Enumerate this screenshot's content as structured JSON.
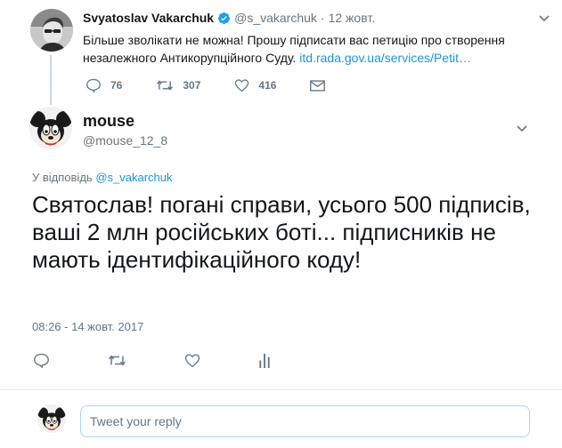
{
  "parent_tweet": {
    "author_name": "Svyatoslav Vakarchuk",
    "author_handle": "@s_vakarchuk",
    "separator": "·",
    "date": "12 жовт.",
    "text": "Більше зволікати не можна! Прошу підписати вас петицію про створення незалежного Антикорупційного Суду.",
    "link_text": "itd.rada.gov.ua/services/Petit…",
    "reply_count": "76",
    "retweet_count": "307",
    "like_count": "416",
    "verified": true
  },
  "main_tweet": {
    "author_name": "mouse",
    "author_handle": "@mouse_12_8",
    "replying_label": "У відповідь",
    "replying_to": "@s_vakarchuk",
    "text": "Святослав! погані справи, усього 500 підписів, ваші 2 млн російських боті... підписників не мають ідентифікаційного коду!",
    "timestamp": "08:26 - 14 жовт. 2017"
  },
  "compose": {
    "placeholder": "Tweet your reply"
  },
  "icons": {
    "reply": "reply-icon",
    "retweet": "retweet-icon",
    "like": "heart-icon",
    "dm": "envelope-icon",
    "analytics": "analytics-icon",
    "more": "chevron-down-icon",
    "verified": "verified-badge-icon"
  },
  "colors": {
    "accent": "#1b95e0",
    "muted": "#657786",
    "text": "#14171a",
    "thread_line": "#ccd6dd",
    "divider": "#e6ecf0",
    "compose_border": "#a4d9f9"
  }
}
